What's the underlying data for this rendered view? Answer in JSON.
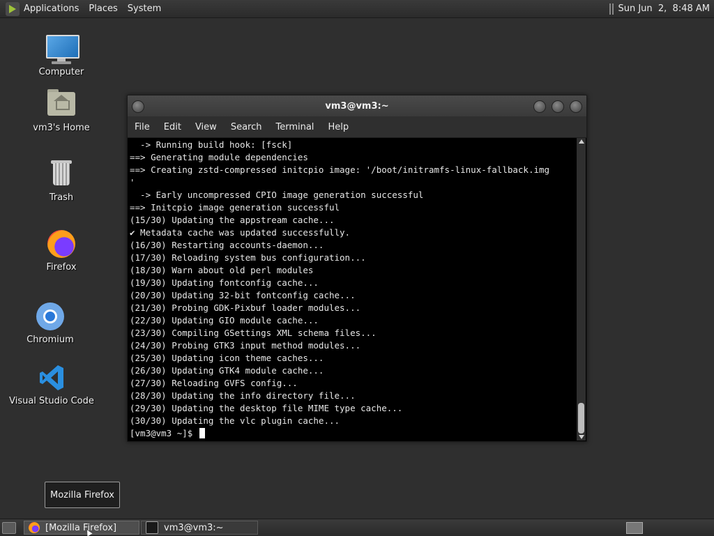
{
  "top_panel": {
    "menus": [
      "Applications",
      "Places",
      "System"
    ],
    "clock": "Sun Jun  2,  8:48 AM"
  },
  "desktop_icons": [
    {
      "label": "Computer",
      "icon": "computer-icon"
    },
    {
      "label": "vm3's Home",
      "icon": "home-folder-icon"
    },
    {
      "label": "Trash",
      "icon": "trash-icon"
    },
    {
      "label": "Firefox",
      "icon": "firefox-icon"
    },
    {
      "label": "Chromium",
      "icon": "chromium-icon"
    },
    {
      "label": "Visual Studio Code",
      "icon": "vscode-icon"
    }
  ],
  "terminal": {
    "title": "vm3@vm3:~",
    "menu": [
      "File",
      "Edit",
      "View",
      "Search",
      "Terminal",
      "Help"
    ],
    "lines": [
      "  -> Running build hook: [fsck]",
      "==> Generating module dependencies",
      "==> Creating zstd-compressed initcpio image: '/boot/initramfs-linux-fallback.img",
      "'",
      "  -> Early uncompressed CPIO image generation successful",
      "==> Initcpio image generation successful",
      "(15/30) Updating the appstream cache...",
      "✔ Metadata cache was updated successfully.",
      "(16/30) Restarting accounts-daemon...",
      "(17/30) Reloading system bus configuration...",
      "(18/30) Warn about old perl modules",
      "(19/30) Updating fontconfig cache...",
      "(20/30) Updating 32-bit fontconfig cache...",
      "(21/30) Probing GDK-Pixbuf loader modules...",
      "(22/30) Updating GIO module cache...",
      "(23/30) Compiling GSettings XML schema files...",
      "(24/30) Probing GTK3 input method modules...",
      "(25/30) Updating icon theme caches...",
      "(26/30) Updating GTK4 module cache...",
      "(27/30) Reloading GVFS config...",
      "(28/30) Updating the info directory file...",
      "(29/30) Updating the desktop file MIME type cache...",
      "(30/30) Updating the vlc plugin cache..."
    ],
    "prompt": "[vm3@vm3 ~]$ "
  },
  "tooltip": "Mozilla Firefox",
  "taskbar": {
    "items": [
      {
        "label": "[Mozilla Firefox]",
        "icon": "firefox-icon"
      },
      {
        "label": "vm3@vm3:~",
        "icon": "terminal-icon"
      }
    ]
  }
}
